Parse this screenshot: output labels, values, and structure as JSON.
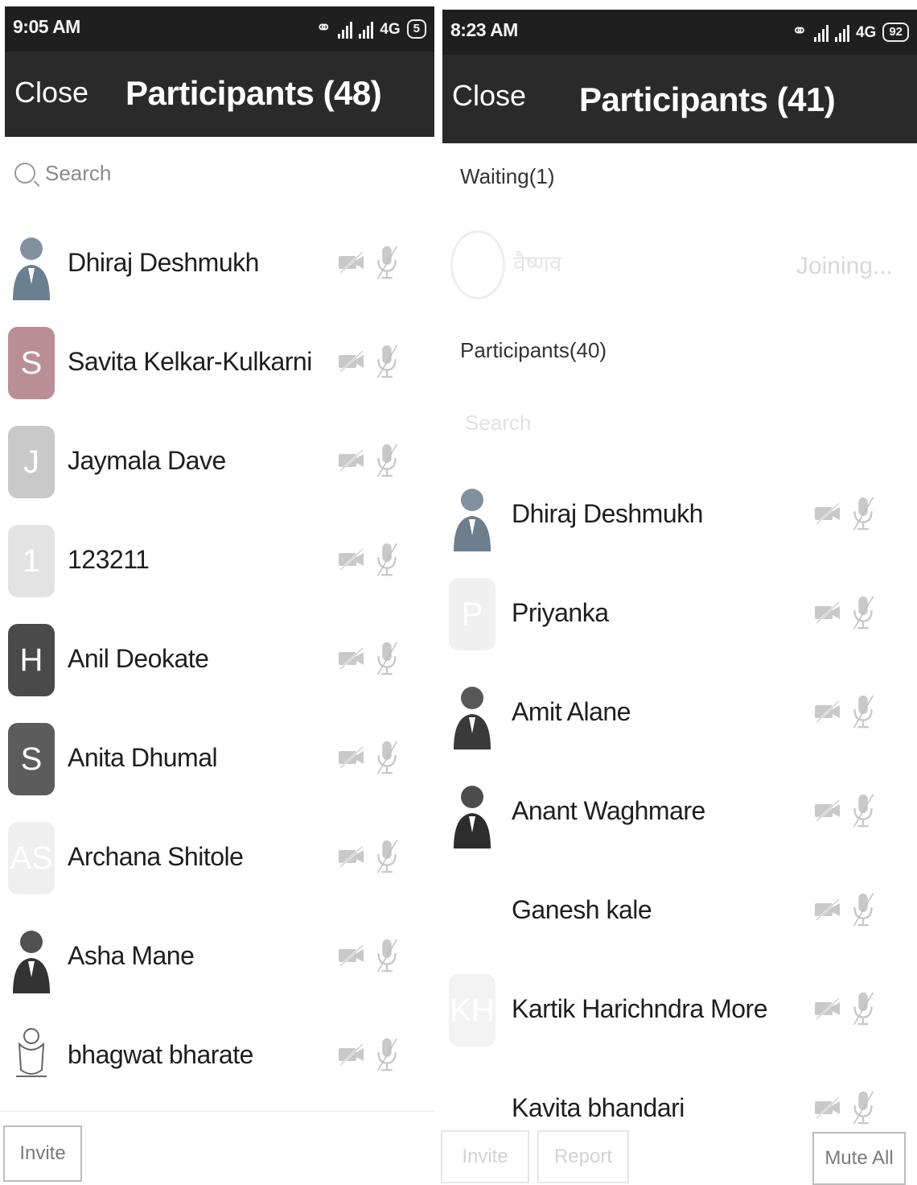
{
  "left": {
    "status": {
      "time": "9:05 AM",
      "network": "4G",
      "battery": "5"
    },
    "header": {
      "close_label": "Close",
      "title": "Participants (48)"
    },
    "search": {
      "placeholder": "Search"
    },
    "participants": [
      {
        "name": "Dhiraj Deshmukh",
        "avatar": "photo",
        "initial": "",
        "color": "#6b7f8e"
      },
      {
        "name": "Savita Kelkar-Kulkarni",
        "avatar": "initial",
        "initial": "S",
        "color": "#b98f95"
      },
      {
        "name": "Jaymala Dave",
        "avatar": "initial",
        "initial": "J",
        "color": "#c9c9c9"
      },
      {
        "name": "123211",
        "avatar": "initial",
        "initial": "1",
        "color": "#e3e3e3"
      },
      {
        "name": "Anil Deokate",
        "avatar": "initial",
        "initial": "H",
        "color": "#4a4a4a"
      },
      {
        "name": "Anita Dhumal",
        "avatar": "initial",
        "initial": "S",
        "color": "#5c5c5c"
      },
      {
        "name": "Archana Shitole",
        "avatar": "initial",
        "initial": "AS",
        "color": "#efefef"
      },
      {
        "name": "Asha Mane",
        "avatar": "photo",
        "initial": "",
        "color": "#333333"
      },
      {
        "name": "bhagwat bharate",
        "avatar": "emblem",
        "initial": "",
        "color": "#777777"
      }
    ],
    "buttons": {
      "invite": "Invite"
    }
  },
  "right": {
    "status": {
      "time": "8:23 AM",
      "network": "4G",
      "battery": "92"
    },
    "header": {
      "close_label": "Close",
      "title": "Participants (41)"
    },
    "waiting_label": "Waiting(1)",
    "waiting_user": {
      "name": "वैष्णव",
      "status": "Joining..."
    },
    "participants_label": "Participants(40)",
    "search": {
      "placeholder": "Search"
    },
    "participants": [
      {
        "name": "Dhiraj Deshmukh",
        "avatar": "photo",
        "initial": "",
        "color": "#6b7f8e"
      },
      {
        "name": "Priyanka",
        "avatar": "initial",
        "initial": "P",
        "color": "#f0f0f0"
      },
      {
        "name": "Amit Alane",
        "avatar": "photo",
        "initial": "",
        "color": "#3a3a3a"
      },
      {
        "name": "Anant Waghmare",
        "avatar": "photo",
        "initial": "",
        "color": "#2d2d2d"
      },
      {
        "name": "Ganesh kale",
        "avatar": "none",
        "initial": "",
        "color": "#ffffff"
      },
      {
        "name": "Kartik Harichndra More",
        "avatar": "initial",
        "initial": "KH",
        "color": "#f3f3f3"
      },
      {
        "name": "Kavita bhandari",
        "avatar": "none",
        "initial": "",
        "color": "#ffffff"
      }
    ],
    "buttons": {
      "invite": "Invite",
      "report": "Report",
      "mute_all": "Mute All"
    }
  }
}
